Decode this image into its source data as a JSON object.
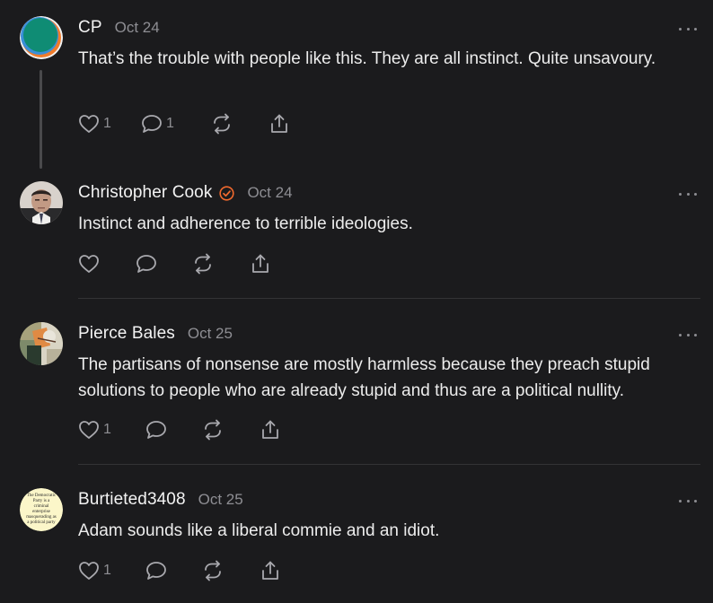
{
  "comments": [
    {
      "author": "CP",
      "date": "Oct 24",
      "text": "That’s the trouble with people like this. They are all instinct. Quite unsavoury.",
      "likes": "1",
      "replies": "1",
      "avatar_icon": "colored-circle-logo-icon",
      "verified": false
    },
    {
      "author": "Christopher Cook",
      "date": "Oct 24",
      "text": "Instinct and adherence to terrible ideologies.",
      "likes": "",
      "replies": "",
      "avatar_icon": "portrait-photo",
      "verified": true,
      "verified_color": "#f26a2e"
    },
    {
      "author": "Pierce Bales",
      "date": "Oct 25",
      "text": "The partisans of nonsense are mostly harmless because they preach stupid solutions to people who are already stupid and thus are a political nullity.",
      "likes": "1",
      "replies": "",
      "avatar_icon": "painting-avatar",
      "verified": false
    },
    {
      "author": "Burtieted3408",
      "date": "Oct 25",
      "text": "Adam sounds like a liberal commie and an idiot.",
      "likes": "1",
      "replies": "",
      "avatar_icon": "text-badge-avatar",
      "avatar_text": "The Democratic Party is a criminal enterprise masquerading as a political party",
      "verified": false
    }
  ],
  "icons": {
    "like": "heart-icon",
    "reply": "comment-bubble-icon",
    "restack": "restack-icon",
    "share": "share-icon",
    "more": "more-dots-icon"
  },
  "colors": {
    "background": "#1b1b1d",
    "text": "#f2f2f2",
    "muted": "#8e8e93",
    "icon": "#a9a9ae",
    "verified": "#f26a2e"
  }
}
